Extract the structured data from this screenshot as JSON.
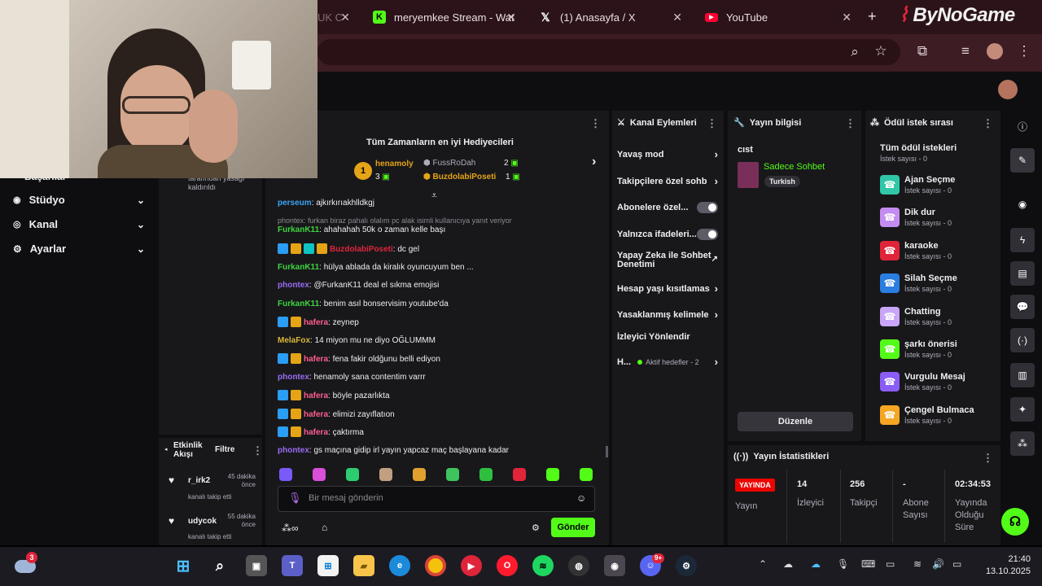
{
  "browser": {
    "tabs": [
      {
        "label": "UK C",
        "icon": "kick-icon"
      },
      {
        "label": "meryemkee Stream - Wat",
        "icon": "kick-icon"
      },
      {
        "label": "(1) Anasayfa / X",
        "icon": "x-icon"
      },
      {
        "label": "YouTube",
        "icon": "youtube-icon"
      }
    ],
    "new_tab": "+",
    "watermark": "ByNoGame"
  },
  "sidebar": {
    "partial_top": "Başarılar",
    "items": [
      {
        "label": "Stüdyo",
        "icon": "studio-icon"
      },
      {
        "label": "Kanal",
        "icon": "channel-icon"
      },
      {
        "label": "Ayarlar",
        "icon": "gear-icon"
      }
    ]
  },
  "mod_notice": {
    "line1": "tarafından yasağı",
    "line2": "kaldırıldı"
  },
  "activity": {
    "title": "Etkinlik Akışı",
    "filter": "Filtre",
    "items": [
      {
        "user": "r_irk2",
        "time": "45 dakika önce",
        "action": "kanalı takip etti"
      },
      {
        "user": "udycok",
        "time": "55 dakika önce",
        "action": "kanalı takip etti"
      }
    ]
  },
  "gifters": {
    "title": "Tüm Zamanların en iyi Hediyecileri",
    "first": {
      "rank": "1",
      "name": "henamoly",
      "count": "3"
    },
    "second": {
      "name": "FussRoDah",
      "count": "2"
    },
    "third": {
      "name": "BuzdolabiPoseti",
      "count": "1"
    }
  },
  "chat": {
    "messages": [
      {
        "user": "perseum",
        "text": ": ajkırkırıakhlldkgj",
        "cls": "u-pers",
        "badges": []
      },
      {
        "user": "",
        "text": "phontex: furkan biraz pahalı olalım pc alak isimli kullanıcıya yanıt veriyor",
        "cls": "",
        "badges": [],
        "reply": true
      },
      {
        "user": "FurkanK11",
        "text": ": ahahahah 50k o zaman kelle başı",
        "cls": "u-furkan",
        "badges": []
      },
      {
        "user": "BuzdolabiPoseti",
        "text": ": dc gel",
        "cls": "u-buz",
        "badges": [
          "b-blue",
          "b-gold",
          "b-cyan",
          "b-gold"
        ]
      },
      {
        "user": "FurkanK11",
        "text": ": hülya ablada da kiralık oyuncuyum ben ...",
        "cls": "u-furkan",
        "badges": []
      },
      {
        "user": "phontex",
        "text": ": @FurkanK11 deal el sıkma emojisi",
        "cls": "u-phontex",
        "badges": []
      },
      {
        "user": "FurkanK11",
        "text": ": benim asıl bonservisim youtube'da",
        "cls": "u-furkan",
        "badges": []
      },
      {
        "user": "hafera",
        "text": ": zeynep",
        "cls": "u-hafera",
        "badges": [
          "b-blue",
          "b-gold"
        ]
      },
      {
        "user": "MelaFox",
        "text": ": 14 miyon mu ne diyo OĞLUMMM",
        "cls": "u-mela",
        "badges": []
      },
      {
        "user": "hafera",
        "text": ": fena fakir oldğunu belli ediyon",
        "cls": "u-hafera",
        "badges": [
          "b-blue",
          "b-gold"
        ]
      },
      {
        "user": "phontex",
        "text": ": henamoly sana contentim varrr",
        "cls": "u-phontex",
        "badges": []
      },
      {
        "user": "hafera",
        "text": ": böyle pazarlıkta",
        "cls": "u-hafera",
        "badges": [
          "b-blue",
          "b-gold"
        ]
      },
      {
        "user": "hafera",
        "text": ": elimizi zayıflatıon",
        "cls": "u-hafera",
        "badges": [
          "b-blue",
          "b-gold"
        ]
      },
      {
        "user": "hafera",
        "text": ": çaktırma",
        "cls": "u-hafera",
        "badges": [
          "b-blue",
          "b-gold"
        ]
      },
      {
        "user": "phontex",
        "text": ": gs maçına gidip irl yayın yapcaz maç başlayana kadar",
        "cls": "u-phontex",
        "badges": []
      }
    ],
    "input_placeholder": "Bir mesaj gönderin",
    "send": "Gönder"
  },
  "channel_actions": {
    "title": "Kanal Eylemleri",
    "items": [
      {
        "label": "Yavaş mod",
        "control": "chevron"
      },
      {
        "label": "Takipçilere özel sohb",
        "control": "chevron"
      },
      {
        "label": "Abonelere özel...",
        "control": "toggle"
      },
      {
        "label": "Yalnızca ifadeleri...",
        "control": "toggle"
      },
      {
        "label": "Yapay Zeka ile Sohbet Denetimi",
        "control": "external"
      },
      {
        "label": "Hesap yaşı kısıtlamas",
        "control": "chevron"
      },
      {
        "label": "Yasaklanmış kelimele",
        "control": "chevron"
      },
      {
        "label": "İzleyici Yönlendir",
        "control": "none"
      }
    ],
    "goals": {
      "label": "H...",
      "status": "Aktif hedefler - 2"
    }
  },
  "stream_info": {
    "title": "Yayın bilgisi",
    "stream_title": "cıst",
    "category": "Sadece Sohbet",
    "tag": "Turkish",
    "edit": "Düzenle"
  },
  "rewards": {
    "title": "Ödül istek sırası",
    "all": "Tüm ödül istekleri",
    "all_count": "İstek sayısı - 0",
    "items": [
      {
        "name": "Ajan Seçme",
        "count": "İstek sayısı - 0",
        "color": "#2fc7a8"
      },
      {
        "name": "Dik dur",
        "count": "İstek sayısı - 0",
        "color": "#c48cf0"
      },
      {
        "name": "karaoke",
        "count": "İstek sayısı - 0",
        "color": "#e0243a"
      },
      {
        "name": "Silah Seçme",
        "count": "İstek sayısı - 0",
        "color": "#2a7de1"
      },
      {
        "name": "Chatting",
        "count": "İstek sayısı - 0",
        "color": "#c9a6f7"
      },
      {
        "name": "şarkı önerisi",
        "count": "İstek sayısı - 0",
        "color": "#53fc18"
      },
      {
        "name": "Vurgulu Mesaj",
        "count": "İstek sayısı - 0",
        "color": "#8b5cf6"
      },
      {
        "name": "Çengel Bulmaca",
        "count": "İstek sayısı - 0",
        "color": "#f5a623"
      }
    ]
  },
  "stats": {
    "title": "Yayın İstatistikleri",
    "live": "YAYINDA",
    "live_label": "Yayın",
    "viewers": "14",
    "viewers_label": "İzleyici",
    "followers": "256",
    "followers_label": "Takipçi",
    "subs": "-",
    "subs_label": "Abone Sayısı",
    "uptime": "02:34:53",
    "uptime_label": "Yayında Olduğu Süre"
  },
  "taskbar": {
    "time": "21:40",
    "date": "13.10.2025",
    "weather_badge": "3",
    "discord_badge": "9+"
  },
  "colors": {
    "kick_green": "#53fc18",
    "live_red": "#eb0400",
    "panel": "#18181b"
  }
}
